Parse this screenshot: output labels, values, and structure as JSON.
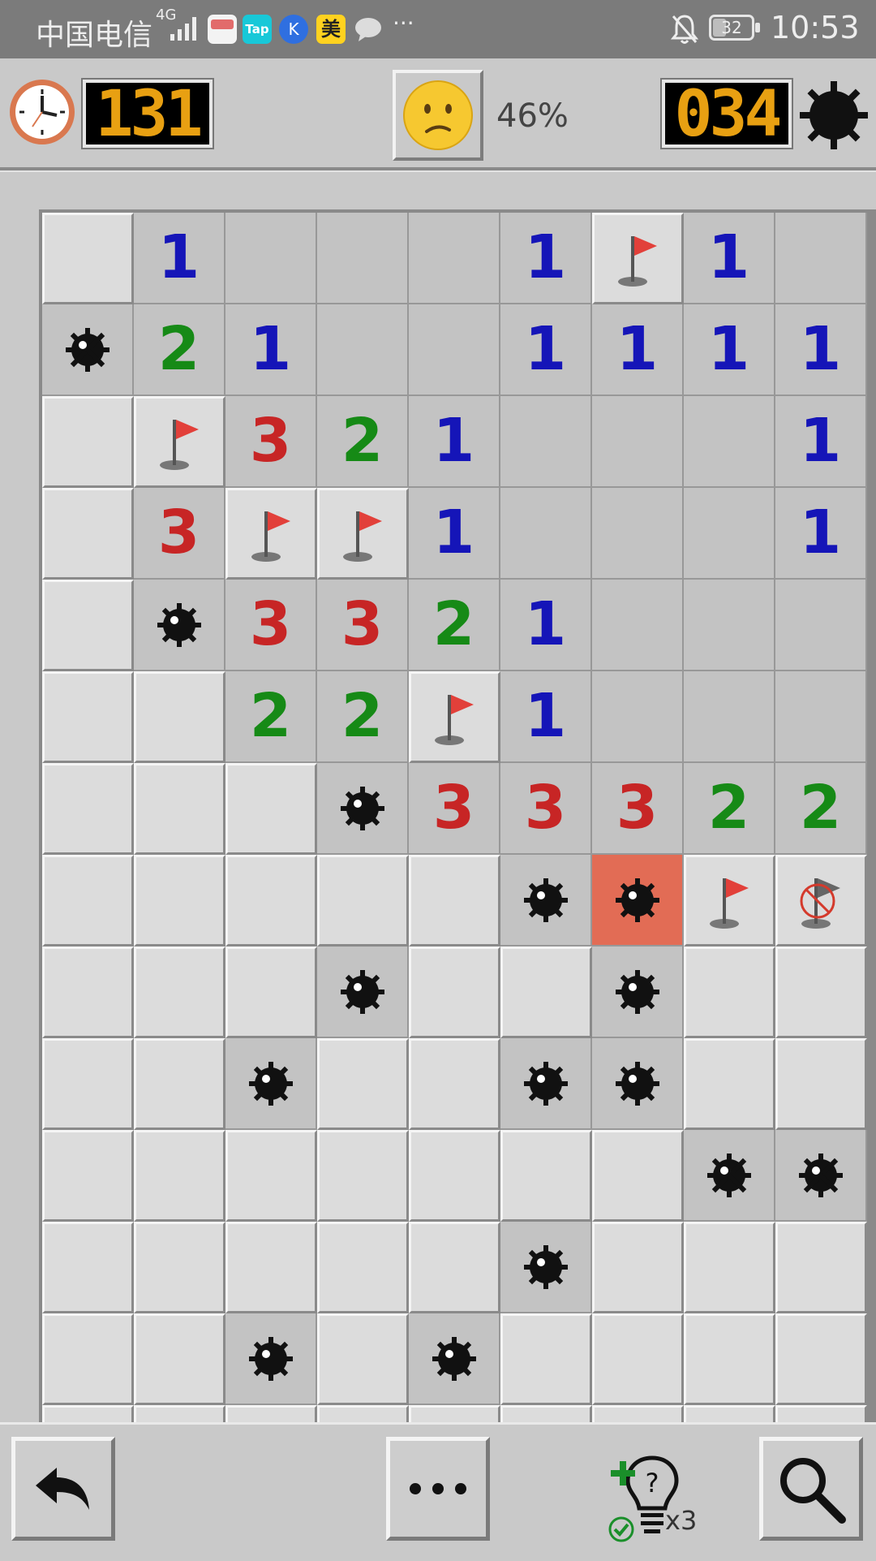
{
  "status_bar": {
    "carrier": "中国电信",
    "network": "4G",
    "battery": "32",
    "time": "10:53",
    "app_icons": [
      "book-icon",
      "tap-icon",
      "k-icon",
      "mei-icon",
      "message-icon"
    ],
    "mei_label": "美",
    "tap_label": "Tap",
    "k_label": "K",
    "more": "···"
  },
  "header": {
    "timer": "131",
    "progress": "46%",
    "mines_remaining": "034",
    "face": "worried-face"
  },
  "colors": {
    "lcd_digits": "#e8a012",
    "num1": "#1515b8",
    "num2": "#168a16",
    "num3": "#c72525",
    "exploded": "#e26c55"
  },
  "board": {
    "legend": {
      "C": "covered",
      "O": "empty",
      "F": "flag",
      "M": "mine",
      "X": "exploded-mine",
      "W": "wrong-flag",
      "1": "one",
      "2": "two",
      "3": "three"
    },
    "rows": [
      [
        "C",
        "1",
        "O",
        "O",
        "O",
        "1",
        "F",
        "1",
        "O"
      ],
      [
        "M",
        "2",
        "1",
        "O",
        "O",
        "1",
        "1",
        "1",
        "1"
      ],
      [
        "C",
        "F",
        "3",
        "2",
        "1",
        "O",
        "O",
        "O",
        "1"
      ],
      [
        "C",
        "3",
        "F",
        "F",
        "1",
        "O",
        "O",
        "O",
        "1"
      ],
      [
        "C",
        "M",
        "3",
        "3",
        "2",
        "1",
        "O",
        "O",
        "O"
      ],
      [
        "C",
        "C",
        "2",
        "2",
        "F",
        "1",
        "O",
        "O",
        "O"
      ],
      [
        "C",
        "C",
        "C",
        "M",
        "3",
        "3",
        "3",
        "2",
        "2"
      ],
      [
        "C",
        "C",
        "C",
        "C",
        "C",
        "M",
        "X",
        "F",
        "W"
      ],
      [
        "C",
        "C",
        "C",
        "M",
        "C",
        "C",
        "M",
        "C",
        "C"
      ],
      [
        "C",
        "C",
        "M",
        "C",
        "C",
        "M",
        "M",
        "C",
        "C"
      ],
      [
        "C",
        "C",
        "C",
        "C",
        "C",
        "C",
        "C",
        "M",
        "M"
      ],
      [
        "C",
        "C",
        "C",
        "C",
        "C",
        "M",
        "C",
        "C",
        "C"
      ],
      [
        "C",
        "C",
        "M",
        "C",
        "M",
        "C",
        "C",
        "C",
        "C"
      ],
      [
        "C",
        "C",
        "C",
        "C",
        "C",
        "C",
        "C",
        "C",
        "C"
      ]
    ]
  },
  "toolbar": {
    "undo": "undo-icon",
    "more": "more-icon",
    "hint": "hint-icon",
    "hint_count": "x3",
    "search": "search-icon"
  }
}
